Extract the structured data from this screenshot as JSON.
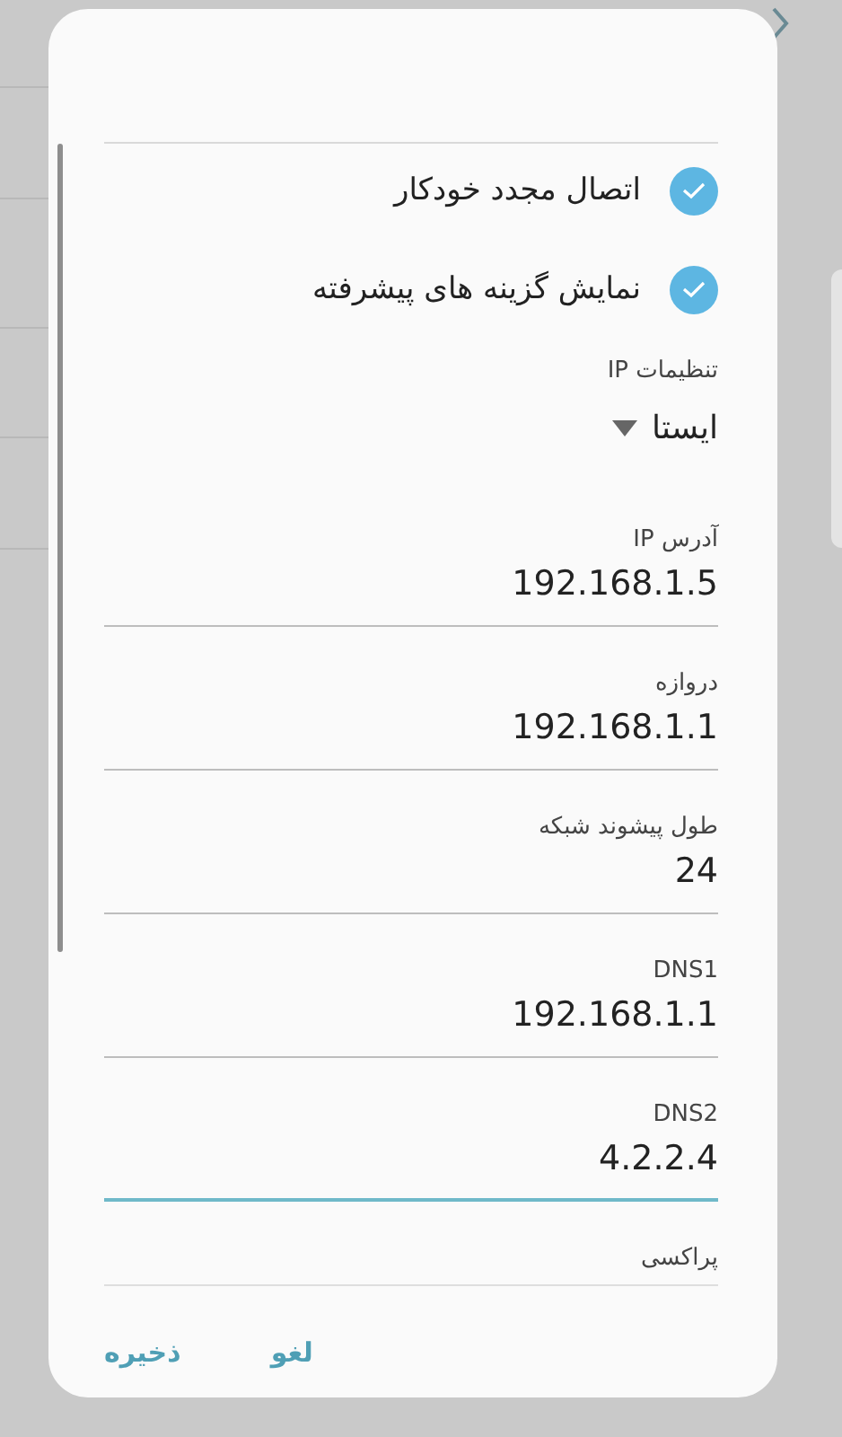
{
  "options": [
    {
      "label": "اتصال مجدد خودکار",
      "checked": true
    },
    {
      "label": "نمایش گزینه های پیشرفته",
      "checked": true
    }
  ],
  "ip_settings": {
    "label": "تنظیمات IP",
    "value": "ایستا"
  },
  "fields": [
    {
      "label": "آدرس IP",
      "value": "192.168.1.5",
      "focused": false
    },
    {
      "label": "دروازه",
      "value": "192.168.1.1",
      "focused": false
    },
    {
      "label": "طول پیشوند شبکه",
      "value": "24",
      "focused": false
    },
    {
      "label": "DNS1",
      "value": "192.168.1.1",
      "focused": false
    },
    {
      "label": "DNS2",
      "value": "4.2.2.4",
      "focused": true
    }
  ],
  "proxy": {
    "label": "پراکسی"
  },
  "buttons": [
    {
      "label": "لغو"
    },
    {
      "label": "ذخیره"
    }
  ]
}
